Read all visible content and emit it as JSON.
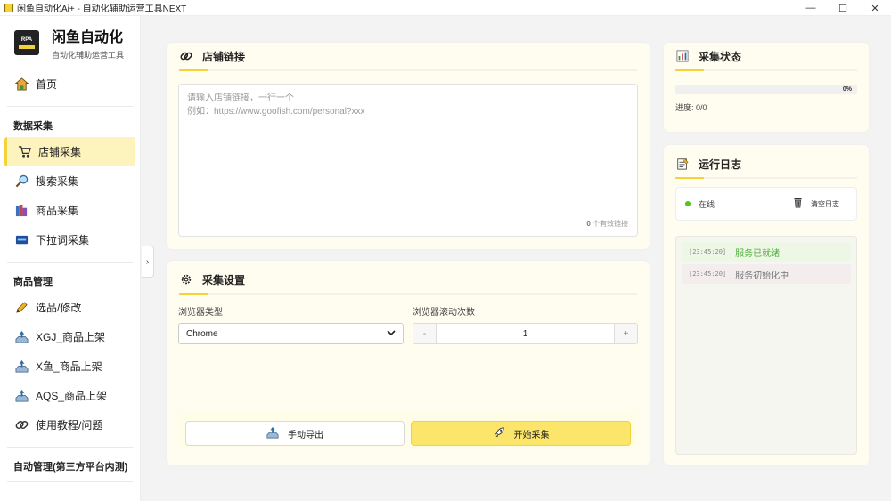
{
  "window": {
    "title": "闲鱼自动化Ai+ - 自动化辅助运营工具NEXT",
    "minimize": "—",
    "maximize": "☐",
    "close": "✕"
  },
  "brand": {
    "name": "闲鱼自动化",
    "subtitle": "自动化辅助运营工具",
    "logo_text": "RPA"
  },
  "sidebar": {
    "home": "首页",
    "sections": [
      {
        "title": "数据采集",
        "items": [
          {
            "label": "店铺采集",
            "icon": "cart-icon",
            "active": true
          },
          {
            "label": "搜索采集",
            "icon": "magnifier-icon",
            "active": false
          },
          {
            "label": "商品采集",
            "icon": "books-icon",
            "active": false
          },
          {
            "label": "下拉词采集",
            "icon": "tag-icon",
            "active": false
          }
        ]
      },
      {
        "title": "商品管理",
        "items": [
          {
            "label": "选品/修改",
            "icon": "pencil-icon"
          },
          {
            "label": "XGJ_商品上架",
            "icon": "upload-tray-icon"
          },
          {
            "label": "X鱼_商品上架",
            "icon": "upload-tray-icon"
          },
          {
            "label": "AQS_商品上架",
            "icon": "upload-tray-icon"
          },
          {
            "label": "使用教程/问题",
            "icon": "link-icon"
          }
        ]
      },
      {
        "title": "自动管理(第三方平台内测)",
        "items": []
      }
    ],
    "collapse": "›"
  },
  "shop_link": {
    "title": "店铺链接",
    "placeholder_line1": "请输入店铺链接，一行一个",
    "placeholder_line2": "例如：https://www.goofish.com/personal?xxx",
    "count_value": "0",
    "count_label": " 个有效链接"
  },
  "settings": {
    "title": "采集设置",
    "browser_label": "浏览器类型",
    "browser_value": "Chrome",
    "scroll_label": "浏览器滚动次数",
    "scroll_value": "1",
    "minus": "-",
    "plus": "+",
    "export_label": "手动导出",
    "start_label": "开始采集"
  },
  "status": {
    "title": "采集状态",
    "progress_percent": "0%",
    "progress_fraction": 0,
    "progress_text": "进度: 0/0"
  },
  "log": {
    "title": "运行日志",
    "online": "在线",
    "clear": "清空日志",
    "entries": [
      {
        "time": "[23:45:20]",
        "msg": "服务已就绪",
        "type": "ok"
      },
      {
        "time": "[23:45:20]",
        "msg": "服务初始化中",
        "type": "info"
      }
    ]
  },
  "colors": {
    "accent": "#f4d23a",
    "start_button": "#fbe56a",
    "active_nav": "#fdf3bd",
    "online_dot": "#52c41a"
  }
}
